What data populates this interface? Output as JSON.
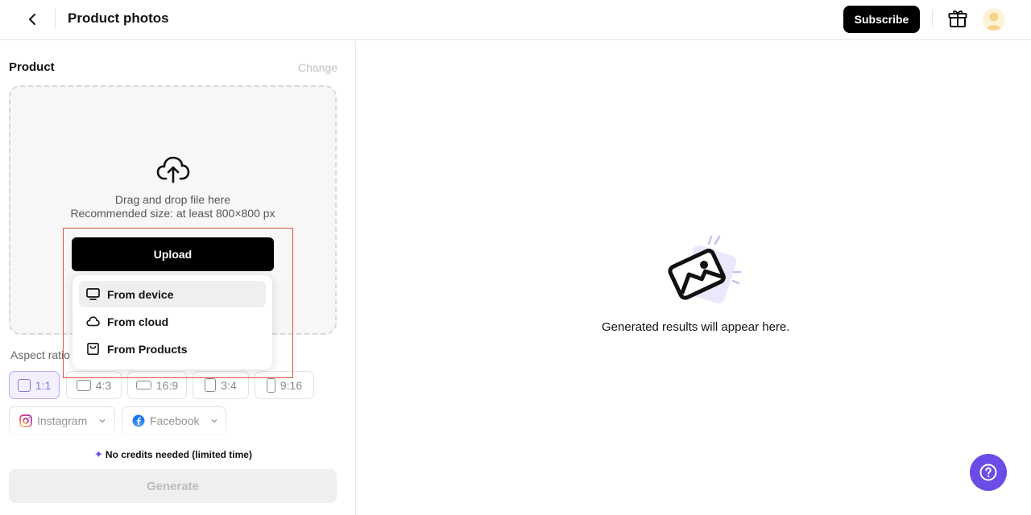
{
  "header": {
    "title": "Product photos",
    "subscribe_label": "Subscribe"
  },
  "product": {
    "section_title": "Product",
    "change_label": "Change",
    "drop_line1": "Drag and drop file here",
    "drop_line2": "Recommended size: at least 800×800 px",
    "upload_label": "Upload",
    "menu_items": [
      {
        "label": "From device",
        "icon": "monitor-icon"
      },
      {
        "label": "From cloud",
        "icon": "cloud-icon"
      },
      {
        "label": "From Products",
        "icon": "bag-icon"
      }
    ]
  },
  "aspect": {
    "label": "Aspect ratio",
    "ratios": [
      "1:1",
      "4:3",
      "16:9",
      "3:4",
      "9:16"
    ],
    "selected": "1:1",
    "socials": [
      "Instagram",
      "Facebook"
    ]
  },
  "credits_note": "No credits needed (limited time)",
  "generate_label": "Generate",
  "results_placeholder": "Generated results will appear here.",
  "colors": {
    "accent": "#6b4ce6",
    "highlight": "#e0533d"
  }
}
